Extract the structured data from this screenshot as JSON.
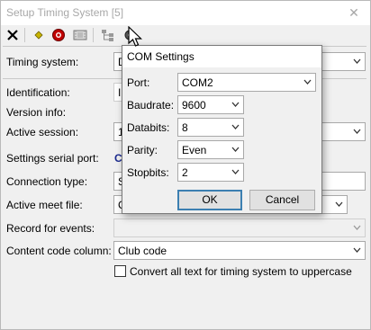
{
  "window": {
    "title": "Setup Timing System [5]",
    "close_symbol": "✕"
  },
  "toolbar": {
    "icons": [
      "close-icon",
      "add-icon",
      "record-icon",
      "film-icon",
      "tree-icon",
      "settings-icon"
    ]
  },
  "form": {
    "timing_system_label": "Timing system:",
    "timing_system_value": "D",
    "identification_label": "Identification:",
    "identification_value": "I",
    "version_info_label": "Version info:",
    "active_session_label": "Active session:",
    "active_session_value": "1",
    "serial_port_label": "Settings serial port:",
    "serial_port_value": "C",
    "connection_type_label": "Connection type:",
    "connection_type_value": "S",
    "active_meet_file_label": "Active meet file:",
    "active_meet_file_value": "C",
    "record_events_label": "Record for events:",
    "record_events_value": "",
    "content_code_label": "Content code column:",
    "content_code_value": "Club code",
    "uppercase_label": "Convert all text for timing system to uppercase"
  },
  "com_dialog": {
    "title": "COM Settings",
    "port_label": "Port:",
    "port_value": "COM2",
    "baudrate_label": "Baudrate:",
    "baudrate_value": "9600",
    "databits_label": "Databits:",
    "databits_value": "8",
    "parity_label": "Parity:",
    "parity_value": "Even",
    "stopbits_label": "Stopbits:",
    "stopbits_value": "2",
    "ok_label": "OK",
    "cancel_label": "Cancel"
  }
}
